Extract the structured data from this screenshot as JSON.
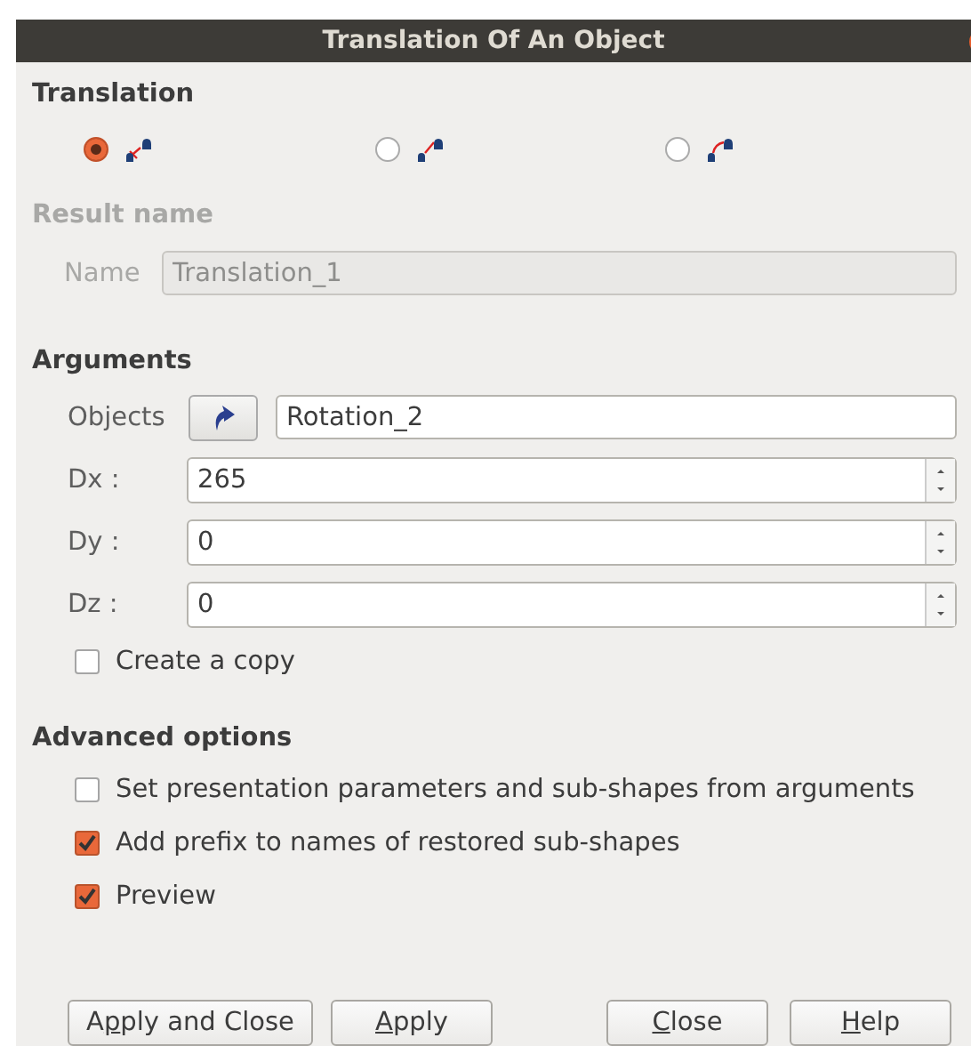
{
  "window": {
    "title": "Translation Of An Object"
  },
  "translation": {
    "title": "Translation",
    "options": [
      {
        "selected": true
      },
      {
        "selected": false
      },
      {
        "selected": false
      }
    ]
  },
  "result_name": {
    "title": "Result name",
    "disabled": true,
    "label": "Name",
    "value": "Translation_1"
  },
  "arguments": {
    "title": "Arguments",
    "objects": {
      "label": "Objects",
      "value": "Rotation_2"
    },
    "spins": [
      {
        "label": "Dx :",
        "value": "265"
      },
      {
        "label": "Dy :",
        "value": "0"
      },
      {
        "label": "Dz :",
        "value": "0"
      }
    ],
    "copy": {
      "label": "Create a copy",
      "checked": false
    }
  },
  "advanced": {
    "title": "Advanced options",
    "options": [
      {
        "label": "Set presentation parameters and sub-shapes from arguments",
        "checked": false
      },
      {
        "label": "Add prefix to names of restored sub-shapes",
        "checked": true
      },
      {
        "label": "Preview",
        "checked": true
      }
    ]
  },
  "buttons": [
    {
      "before": "A",
      "key": "p",
      "after": "ply and Close"
    },
    {
      "key": "A",
      "after": "pply"
    },
    {
      "key": "C",
      "after": "lose"
    },
    {
      "key": "H",
      "after": "elp"
    }
  ]
}
